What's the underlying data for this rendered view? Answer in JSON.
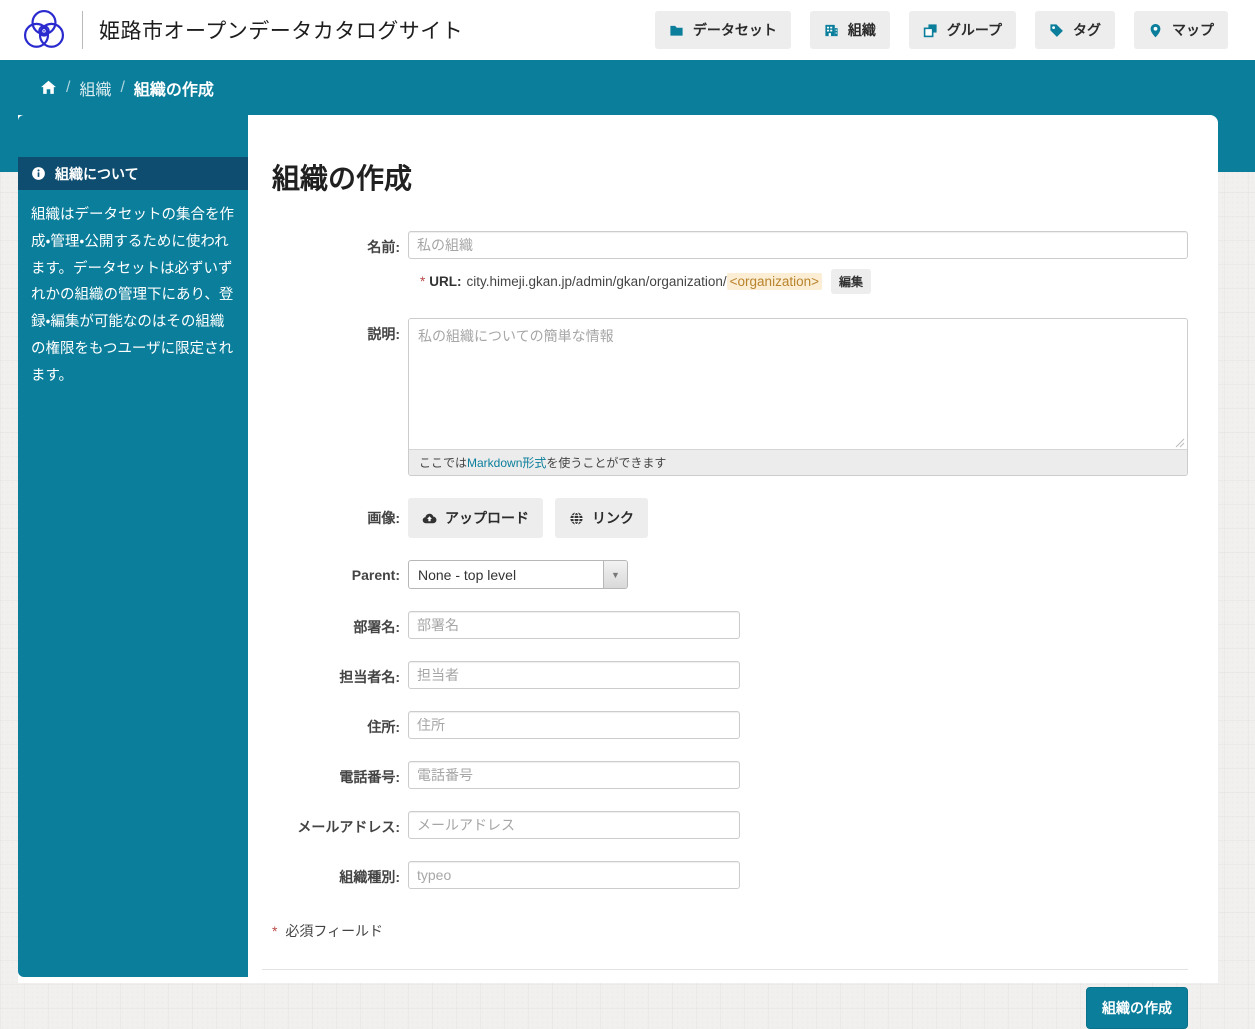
{
  "header": {
    "site_title": "姫路市オープンデータカタログサイト",
    "nav": [
      {
        "label": "データセット",
        "icon": "folder-icon"
      },
      {
        "label": "組織",
        "icon": "building-icon"
      },
      {
        "label": "グループ",
        "icon": "clone-icon"
      },
      {
        "label": "タグ",
        "icon": "tag-icon"
      },
      {
        "label": "マップ",
        "icon": "map-marker-icon"
      }
    ]
  },
  "breadcrumb": {
    "home_icon": "home-icon",
    "separator": "/",
    "parent": "組織",
    "current": "組織の作成"
  },
  "sidebar": {
    "heading": "組織について",
    "body": "組織はデータセットの集合を作成・管理・公開するために使われます。データセットは必ずいずれかの組織の管理下にあり、登録・編集が可能なのはその組織の権限をもつユーザに限定されます。"
  },
  "form": {
    "title": "組織の作成",
    "name_field": {
      "label": "名前:",
      "placeholder": "私の組織"
    },
    "url_line": {
      "required_mark": "*",
      "label": "URL:",
      "prefix": "city.himeji.gkan.jp/admin/gkan/organization/",
      "slug": "<organization>",
      "edit_button": "編集"
    },
    "description_field": {
      "label": "説明:",
      "placeholder": "私の組織についての簡単な情報",
      "markdown_note_pre": "ここでは",
      "markdown_link": "Markdown形式",
      "markdown_note_post": "を使うことができます"
    },
    "image_field": {
      "label": "画像:",
      "upload_button": "アップロード",
      "link_button": "リンク"
    },
    "parent_field": {
      "label": "Parent:",
      "selected_value": "None - top level"
    },
    "fields": [
      {
        "label": "部署名:",
        "placeholder": "部署名"
      },
      {
        "label": "担当者名:",
        "placeholder": "担当者"
      },
      {
        "label": "住所:",
        "placeholder": "住所"
      },
      {
        "label": "電話番号:",
        "placeholder": "電話番号"
      },
      {
        "label": "メールアドレス:",
        "placeholder": "メールアドレス"
      },
      {
        "label": "組織種別:",
        "placeholder": "typeo"
      }
    ],
    "required_note": {
      "mark": "*",
      "text": " 必須フィールド"
    },
    "submit_label": "組織の作成"
  },
  "colors": {
    "accent_teal": "#0a7e9b",
    "sidebar_heading_bg": "#0e4d70",
    "logo_blue": "#2a2acf",
    "slug_highlight_bg": "#fbeed5",
    "slug_highlight_text": "#b9832c",
    "required_red": "#b94a48",
    "button_gray_bg": "#ededed"
  }
}
